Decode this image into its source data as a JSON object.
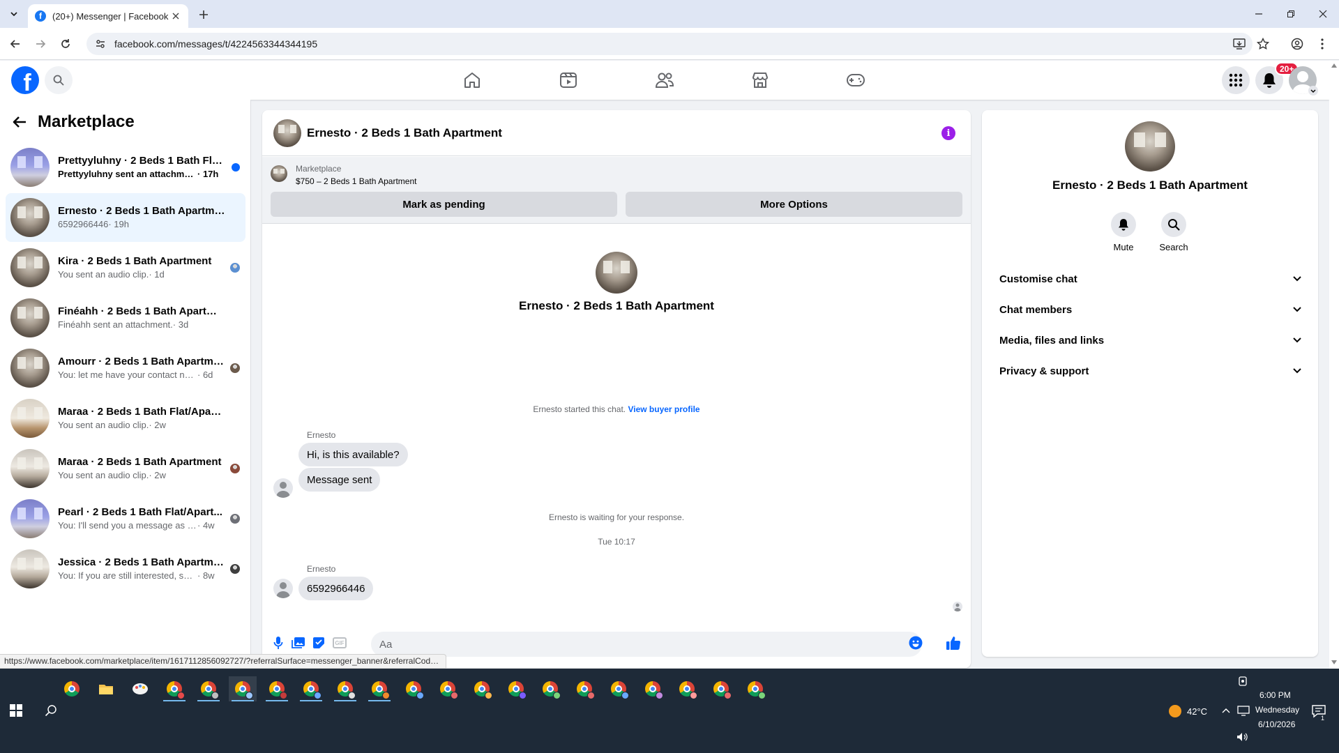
{
  "browser": {
    "tab_title": "(20+) Messenger | Facebook",
    "tab_favicon": "f",
    "url": "facebook.com/messages/t/4224563344344195",
    "status_url": "https://www.facebook.com/marketplace/item/1617112856092727/?referralSurface=messenger_banner&referralCode..."
  },
  "header": {
    "logo": "f",
    "notifications_badge": "20+",
    "nav_icons": [
      "home-icon",
      "video-icon",
      "friends-icon",
      "marketplace-icon",
      "gaming-icon"
    ]
  },
  "sidebar": {
    "title": "Marketplace",
    "conversations": [
      {
        "name": "Prettyyluhny · 2 Beds 1 Bath Flat/...",
        "preview": "Prettyyluhny sent an attachment.",
        "time": " · 17h",
        "unread": true,
        "thumb": "blue"
      },
      {
        "name": "Ernesto · 2 Beds 1 Bath Apartment",
        "preview": "6592966446",
        "time": " · 19h",
        "active": true,
        "thumb": "room"
      },
      {
        "name": "Kira · 2 Beds 1 Bath Apartment",
        "preview": "You sent an audio clip.",
        "time": " · 1d",
        "thumb": "room"
      },
      {
        "name": "Finéahh · 2 Beds 1 Bath Apartment",
        "preview": "Finéahh sent an attachment.",
        "time": " · 3d",
        "thumb": "room"
      },
      {
        "name": "Amourr · 2 Beds 1 Bath Apartme...",
        "preview": "You: let me have your contact num...",
        "time": " · 6d",
        "thumb": "room"
      },
      {
        "name": "Maraa · 2 Beds 1 Bath Flat/Apartm...",
        "preview": "You sent an audio clip.",
        "time": " · 2w",
        "thumb": "light"
      },
      {
        "name": "Maraa · 2 Beds 1 Bath Apartment",
        "preview": "You sent an audio clip.",
        "time": " · 2w",
        "thumb": "kitchen"
      },
      {
        "name": "Pearl · 2 Beds 1 Bath Flat/Apart...",
        "preview": "You: I'll send you a message as soo...",
        "time": " · 4w",
        "thumb": "blue"
      },
      {
        "name": "Jessica · 2 Beds 1 Bath Apartment",
        "preview": "You: If you are still interested, send...",
        "time": " · 8w",
        "thumb": "kitchen"
      }
    ]
  },
  "chat": {
    "title": "Ernesto · 2 Beds 1 Bath Apartment",
    "banner": {
      "kicker": "Marketplace",
      "item": "$750 – 2 Beds 1 Bath Apartment",
      "pending_button": "Mark as pending",
      "options_button": "More Options"
    },
    "intro_name": "Ernesto · 2 Beds 1 Bath Apartment",
    "started_text": "Ernesto started this chat. ",
    "buyer_profile_link": "View buyer profile",
    "sender_1": "Ernesto",
    "msg_1": "Hi, is this available?",
    "msg_2": "Message sent",
    "waiting_text": "Ernesto is waiting for your response.",
    "timestamp": "Tue 10:17",
    "sender_2": "Ernesto",
    "msg_3": "6592966446",
    "composer_placeholder": "Aa"
  },
  "info_panel": {
    "name": "Ernesto · 2 Beds 1 Bath Apartment",
    "mute_label": "Mute",
    "search_label": "Search",
    "sections": [
      "Customise chat",
      "Chat members",
      "Media, files and links",
      "Privacy & support"
    ]
  },
  "taskbar": {
    "weather": "42°C",
    "time": "6:00 PM",
    "day": "Wednesday",
    "date": "6/10/2026",
    "notification_count": "1"
  }
}
